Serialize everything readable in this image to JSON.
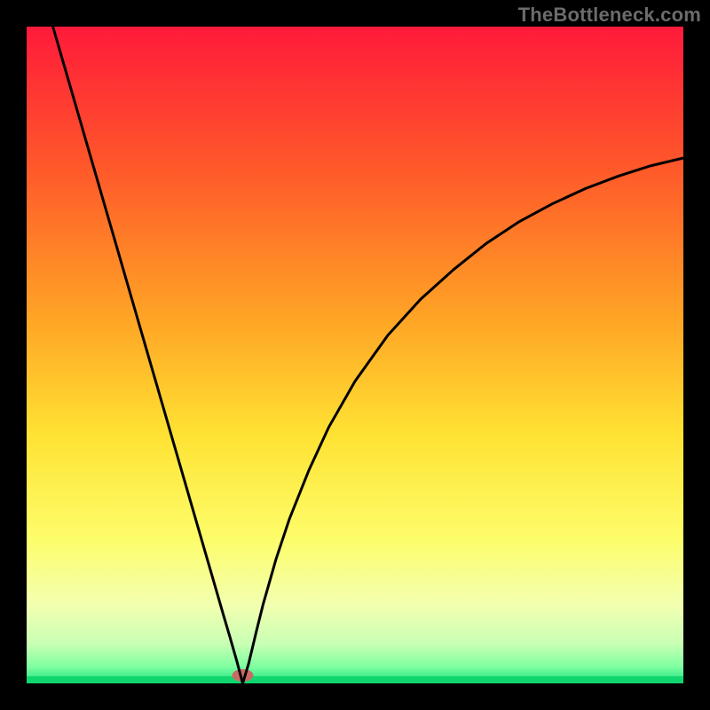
{
  "watermark": "TheBottleneck.com",
  "chart_data": {
    "type": "line",
    "title": "",
    "xlabel": "",
    "ylabel": "",
    "xlim": [
      0,
      100
    ],
    "ylim": [
      0,
      100
    ],
    "legend": false,
    "grid": false,
    "background_gradient": {
      "stops": [
        {
          "offset": 0.0,
          "color": "#ff1a3a"
        },
        {
          "offset": 0.22,
          "color": "#ff5a2a"
        },
        {
          "offset": 0.45,
          "color": "#ffa625"
        },
        {
          "offset": 0.62,
          "color": "#ffe233"
        },
        {
          "offset": 0.78,
          "color": "#fdfd6a"
        },
        {
          "offset": 0.88,
          "color": "#f3ffb0"
        },
        {
          "offset": 0.94,
          "color": "#c8ffb4"
        },
        {
          "offset": 0.975,
          "color": "#7effa0"
        },
        {
          "offset": 1.0,
          "color": "#18e07e"
        }
      ]
    },
    "bottom_band_color": "#10d66f",
    "optimal_marker": {
      "x": 32.9,
      "color": "#c96b63"
    },
    "series": [
      {
        "name": "bottleneck-curve",
        "color": "#000000",
        "x": [
          4.0,
          6.0,
          8.0,
          10.0,
          12.0,
          14.0,
          16.0,
          18.0,
          20.0,
          22.0,
          24.0,
          26.0,
          28.0,
          30.0,
          31.0,
          32.0,
          32.9,
          33.8,
          35.0,
          36.0,
          38.0,
          40.0,
          43.0,
          46.0,
          50.0,
          55.0,
          60.0,
          65.0,
          70.0,
          75.0,
          80.0,
          85.0,
          90.0,
          95.0,
          100.0
        ],
        "y": [
          100.0,
          93.1,
          86.2,
          79.3,
          72.4,
          65.5,
          58.6,
          51.7,
          44.8,
          37.9,
          31.0,
          24.1,
          17.2,
          10.3,
          6.9,
          3.4,
          0.0,
          3.0,
          8.0,
          12.0,
          19.0,
          25.0,
          32.5,
          39.0,
          46.0,
          53.0,
          58.5,
          63.0,
          67.0,
          70.3,
          73.0,
          75.3,
          77.2,
          78.8,
          80.0
        ]
      }
    ]
  }
}
